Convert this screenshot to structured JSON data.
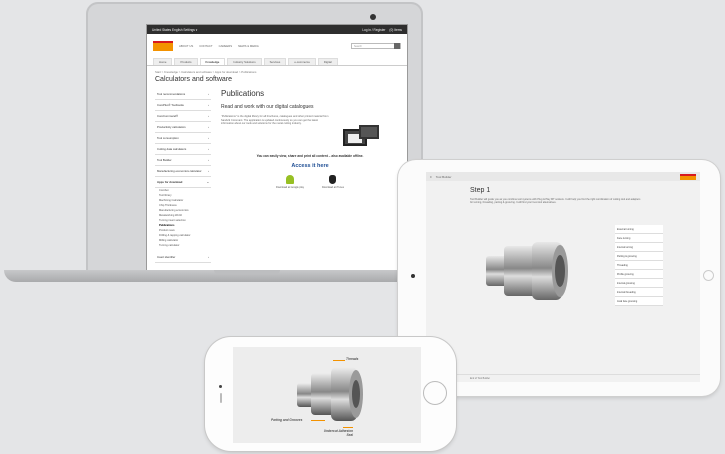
{
  "laptop": {
    "topbar": {
      "left": "United States English  Settings ▾",
      "login": "Log in / Register",
      "items": "(0) Items"
    },
    "brand": "SANDVIK COROMANT",
    "mini_nav": [
      "ABOUT US",
      "CONTACT",
      "CAREERS",
      "NEWS & MEDIA"
    ],
    "search_placeholder": "Search",
    "tabs": [
      "Home",
      "Products",
      "Knowledge",
      "Industry Solutions",
      "Services",
      "e-commerce",
      "Digital"
    ],
    "active_tab": "Knowledge",
    "breadcrumb": "Start  >  Knowledge  >  Calculators and software  >  Apps for download  >  Publications",
    "page_title": "Calculators and software",
    "side_items": [
      "Tool recommendations",
      "CoroPlus® ToolGuide",
      "CoroCommand®",
      "Productivity calculators",
      "Tool consumption",
      "Cutting data calculators",
      "Tool Builder",
      "Manufacturing economics calculator",
      "Apps for download"
    ],
    "sub_items": [
      "CoroSet",
      "Tool library",
      "Machining Calculator",
      "Chip Thickness",
      "Manufacturing economics",
      "Metalworking World",
      "Turning insert selection",
      "Publications",
      "Product news",
      "Drilling & tapping calculator",
      "Milling calculator",
      "Turning calculator"
    ],
    "side_footer": "Insert identifier",
    "publications_title": "Publications",
    "publications_heading": "Read and work with our digital catalogues",
    "publications_text": "“Publications” is the digital library for all brochures, catalogues and other printed material from Sandvik Coromant. The application is updated continuously so you can get the latest information about our tools and solutions for the metal cutting industry.",
    "cta": "You can easily view, share and print all content – also available offline.",
    "access": "Access it here",
    "store_google": "Download at Google play",
    "store_apple": "Download at iTunes"
  },
  "tablet": {
    "app_title": "Tool Builder",
    "step": "Step 1",
    "intro": "Tool Builder will guide you as you combine tool systems with Plug & Play MT sockets. It will help you find the right combination of cutting tool and adapters for turning, threading, parting & grooving. It will find your best tool alternatives.",
    "options": [
      "External turning",
      "Face turning",
      "Internal turning",
      "Parting & grooving",
      "Threading",
      "Profile grooving",
      "Internal grooving",
      "Internal threading",
      "Axial face grooving"
    ],
    "footer": "End of Tool Builder"
  },
  "phone": {
    "callouts": [
      "Threads",
      "Parting and Grooves",
      "Undercut Adhesion Seal"
    ]
  },
  "colors": {
    "brand_orange": "#f39200",
    "brand_red": "#d71920",
    "link_blue": "#1f4e94",
    "android_green": "#97c024"
  }
}
